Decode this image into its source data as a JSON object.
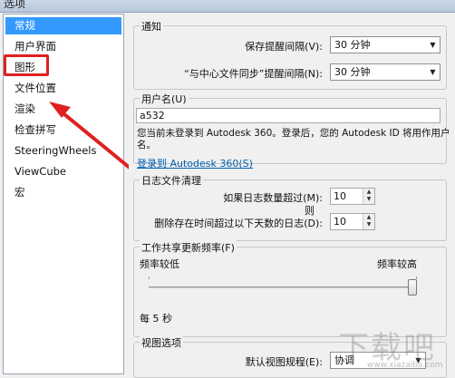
{
  "window": {
    "title": "选项"
  },
  "nav": {
    "items": [
      {
        "label": "常规",
        "selected": true
      },
      {
        "label": "用户界面"
      },
      {
        "label": "图形"
      },
      {
        "label": "文件位置"
      },
      {
        "label": "渲染"
      },
      {
        "label": "检查拼写"
      },
      {
        "label": "SteeringWheels"
      },
      {
        "label": "ViewCube"
      },
      {
        "label": "宏"
      }
    ]
  },
  "notify": {
    "title": "通知",
    "save_reminder_label": "保存提醒间隔(V):",
    "save_reminder_value": "30 分钟",
    "sync_reminder_label": "“与中心文件同步”提醒间隔(N):",
    "sync_reminder_value": "30 分钟"
  },
  "username": {
    "title": "用户名(U)",
    "value": "a532",
    "info_line1": "您当前未登录到 Autodesk 360。登录后，您的 Autodesk ID 将用作用户",
    "info_line2": "名。",
    "login_link": "登录到 Autodesk 360(S)"
  },
  "journal": {
    "title": "日志文件清理",
    "max_count_label": "如果日志数量超过(M):",
    "max_count_value": "10",
    "then_label": "则",
    "delete_days_label": "删除存在时间超过以下天数的日志(D):",
    "delete_days_value": "10"
  },
  "worksharing": {
    "title": "工作共享更新频率(F)",
    "low_label": "频率较低",
    "high_label": "频率较高",
    "frequency_fraction": 1.0,
    "interval_text": "每 5 秒"
  },
  "view": {
    "title": "视图选项",
    "discipline_label": "默认视图规程(E):",
    "discipline_value": "协调"
  },
  "watermark": {
    "big": "下载吧",
    "small": "www.xiazaiba.com"
  },
  "colors": {
    "selected_bg": "#3399ff",
    "callout_red": "#e02020",
    "link": "#0060b0"
  }
}
